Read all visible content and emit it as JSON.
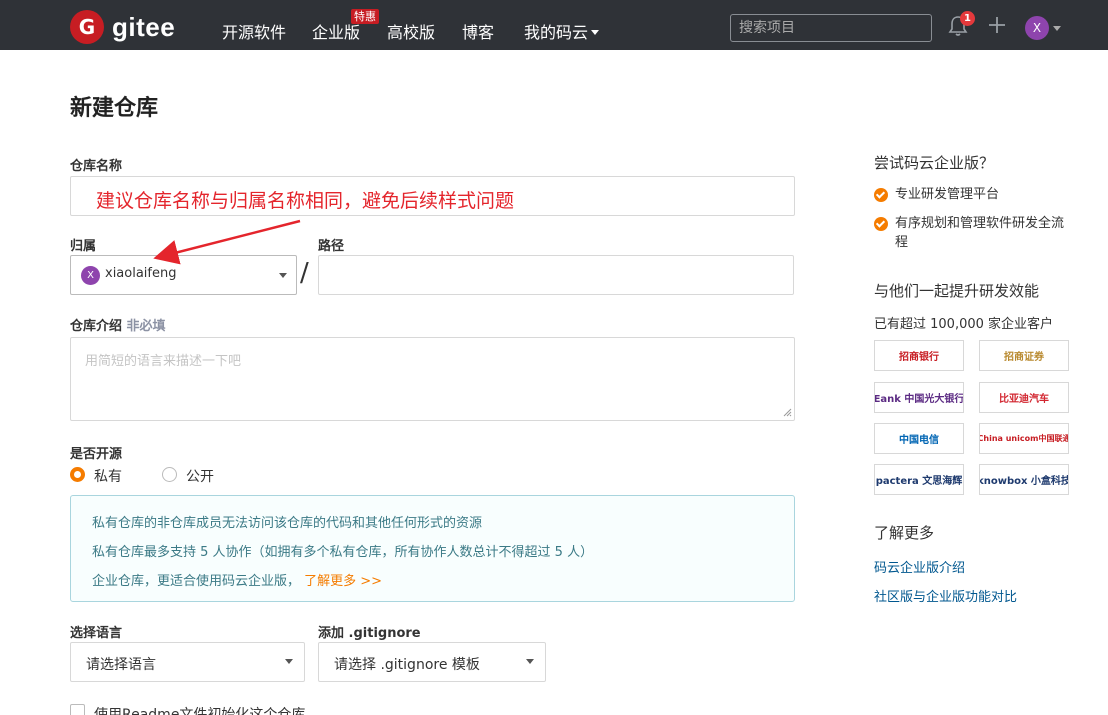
{
  "navbar": {
    "logo_text": "gitee",
    "logo_letter": "G",
    "items": [
      "开源软件",
      "企业版",
      "高校版",
      "博客",
      "我的码云"
    ],
    "badge": "特惠",
    "search_placeholder": "搜索项目",
    "notification_count": "1",
    "avatar_letter": "X",
    "bg_color": "#2f3237",
    "brand_color": "#c71d23"
  },
  "form": {
    "page_title": "新建仓库",
    "repo_name_label": "仓库名称",
    "annotation_text": "建议仓库名称与归属名称相同，避免后续样式问题",
    "owner_label": "归属",
    "path_label": "路径",
    "owner_avatar_letter": "X",
    "owner_value": "xiaolaifeng",
    "path_separator": "/",
    "desc_label": "仓库介绍",
    "desc_optional": "非必填",
    "desc_placeholder": "用简短的语言来描述一下吧",
    "open_source_label": "是否开源",
    "visibility_options": [
      "私有",
      "公开"
    ],
    "visibility_selected": "私有",
    "info_lines": [
      "私有仓库的非仓库成员无法访问该仓库的代码和其他任何形式的资源",
      "私有仓库最多支持 5 人协作（如拥有多个私有仓库，所有协作人数总计不得超过 5 人）",
      "企业仓库，更适合使用码云企业版，"
    ],
    "info_link": "了解更多 >>",
    "language_label": "选择语言",
    "language_value": "请选择语言",
    "gitignore_label": "添加 .gitignore",
    "gitignore_value": "请选择 .gitignore 模板",
    "readme_label": "使用Readme文件初始化这个仓库",
    "accent_color": "#f57c00",
    "annotation_color": "#e4252c"
  },
  "sidebar": {
    "try_title": "尝试码云企业版？",
    "features": [
      "专业研发管理平台",
      "有序规划和管理软件研发全流程"
    ],
    "together_title": "与他们一起提升研发效能",
    "customers_text": "已有超过 100,000 家企业客户",
    "brands": [
      "招商银行",
      "招商证券",
      "Eank 中国光大银行",
      "比亚迪汽车",
      "中国电信",
      "China unicom中国联通",
      "pactera 文思海辉",
      "knowbox 小盒科技"
    ],
    "learn_title": "了解更多",
    "links": [
      "码云企业版介绍",
      "社区版与企业版功能对比"
    ]
  }
}
